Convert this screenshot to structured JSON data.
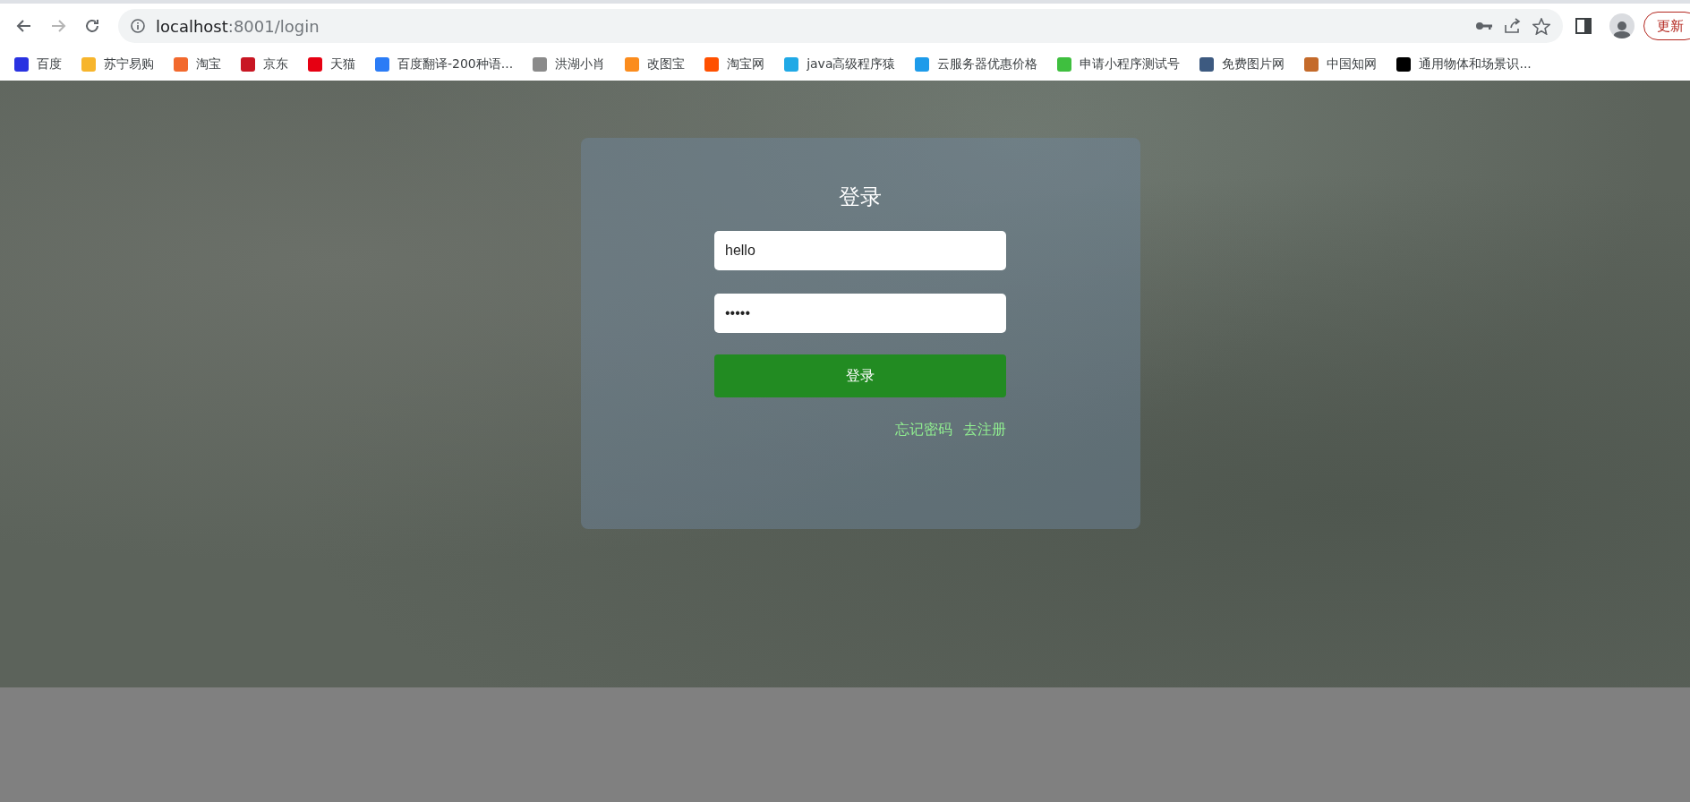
{
  "browser": {
    "back_disabled": false,
    "forward_disabled": true,
    "url_host": "localhost",
    "url_path": ":8001/login",
    "update_button": "更新"
  },
  "bookmarks": [
    {
      "label": "百度",
      "color": "#2932e1"
    },
    {
      "label": "苏宁易购",
      "color": "#f7b52c"
    },
    {
      "label": "淘宝",
      "color": "#f2692d"
    },
    {
      "label": "京东",
      "color": "#c81623"
    },
    {
      "label": "天猫",
      "color": "#e60012"
    },
    {
      "label": "百度翻译-200种语...",
      "color": "#2b7cf6"
    },
    {
      "label": "洪湖小肖",
      "color": "#8a8a8a"
    },
    {
      "label": "改图宝",
      "color": "#fb8c1d"
    },
    {
      "label": "淘宝网",
      "color": "#ff5000"
    },
    {
      "label": "java高级程序猿",
      "color": "#20a9e6"
    },
    {
      "label": "云服务器优惠价格",
      "color": "#1d9bea"
    },
    {
      "label": "申请小程序测试号",
      "color": "#3fbf3f"
    },
    {
      "label": "免费图片网",
      "color": "#3d5a80"
    },
    {
      "label": "中国知网",
      "color": "#c46a2a"
    },
    {
      "label": "通用物体和场景识...",
      "color": "#000000"
    }
  ],
  "login": {
    "title": "登录",
    "username": {
      "value": "hello"
    },
    "password": {
      "value": "•••••"
    },
    "submit": "登录",
    "links": [
      "忘记密码",
      "去注册"
    ]
  }
}
